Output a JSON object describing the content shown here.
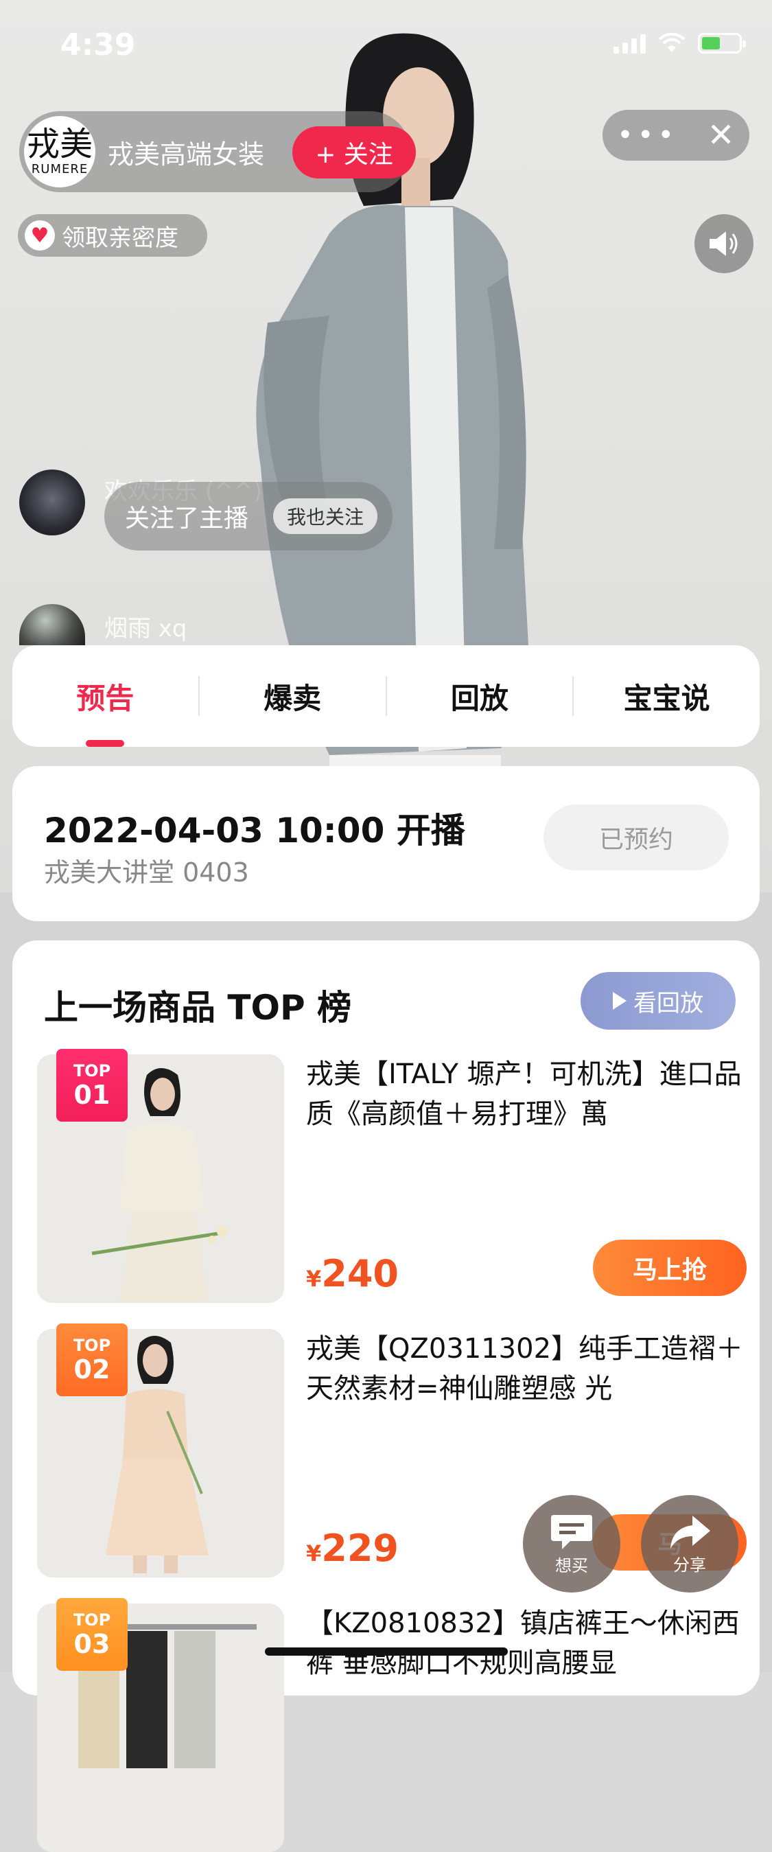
{
  "status": {
    "time": "4:39"
  },
  "store": {
    "avatar_line1": "戎美",
    "avatar_line2": "RUMERE",
    "name": "戎美高端女装",
    "follow": "+ 关注"
  },
  "top_right": {
    "more": "•••",
    "close": "✕"
  },
  "intimacy": {
    "label": "领取亲密度"
  },
  "comments": [
    {
      "user": "欢欢乐乐 (^^)"
    },
    {
      "user": "烟雨 xq"
    }
  ],
  "comment_bubble": {
    "text": "关注了主播",
    "me_too": "我也关注"
  },
  "tabs": [
    {
      "label": "预告",
      "active": true
    },
    {
      "label": "爆卖",
      "active": false
    },
    {
      "label": "回放",
      "active": false
    },
    {
      "label": "宝宝说",
      "active": false
    }
  ],
  "schedule": {
    "datetime": "2022-04-03 10:00 开播",
    "subtitle": "戎美大讲堂 0403",
    "booked": "已预约"
  },
  "top_list": {
    "title": "上一场商品 TOP 榜",
    "replay_button": "看回放",
    "products": [
      {
        "badge_top": "TOP",
        "badge_num": "01",
        "badge_color": "#f21f58",
        "title": "戎美【ITALY 塬产！可机洗】進口品质《高颜值＋易打理》萬",
        "price_symbol": "¥",
        "price": "240",
        "buy": "马上抢"
      },
      {
        "badge_top": "TOP",
        "badge_num": "02",
        "badge_color": "#ff6b24",
        "title": "戎美【QZ0311302】纯手工造褶＋天然素材=神仙雕塑感 光",
        "price_symbol": "¥",
        "price": "229",
        "buy": "马"
      },
      {
        "badge_top": "TOP",
        "badge_num": "03",
        "badge_color": "#ff9a2a",
        "title": "【KZ0810832】镇店裤王～休闲西裤 垂感脚口不规则高腰显",
        "price_symbol": "¥",
        "price": "",
        "buy": ""
      }
    ]
  },
  "floating": {
    "want": "想买",
    "share": "分享"
  }
}
